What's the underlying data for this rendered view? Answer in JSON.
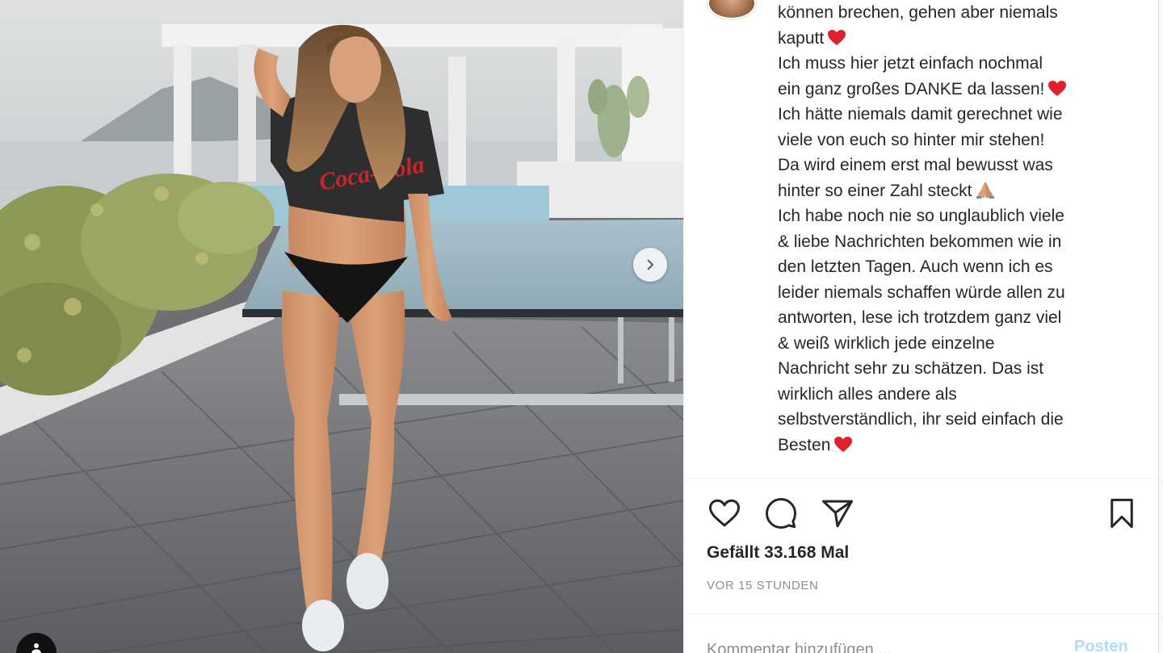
{
  "post": {
    "caption_lines": [
      {
        "text": "können brechen, gehen aber niemals",
        "emoji": ""
      },
      {
        "text": "kaputt",
        "emoji": "heart"
      },
      {
        "text": "Ich muss hier jetzt einfach nochmal",
        "emoji": ""
      },
      {
        "text": "ein ganz großes DANKE da lassen!",
        "emoji": "heart"
      },
      {
        "text": "Ich hätte niemals damit gerechnet wie",
        "emoji": ""
      },
      {
        "text": "viele von euch so hinter mir stehen!",
        "emoji": ""
      },
      {
        "text": "Da wird einem erst mal bewusst was",
        "emoji": ""
      },
      {
        "text": "hinter so einer Zahl steckt",
        "emoji": "folded-hands"
      },
      {
        "text": "Ich habe noch nie so unglaublich viele",
        "emoji": ""
      },
      {
        "text": "& liebe Nachrichten bekommen wie in",
        "emoji": ""
      },
      {
        "text": "den letzten Tagen. Auch wenn ich es",
        "emoji": ""
      },
      {
        "text": "leider niemals schaffen würde allen zu",
        "emoji": ""
      },
      {
        "text": "antworten, lese ich trotzdem ganz viel",
        "emoji": ""
      },
      {
        "text": "& weiß wirklich jede einzelne",
        "emoji": ""
      },
      {
        "text": "Nachricht sehr zu schätzen. Das ist",
        "emoji": ""
      },
      {
        "text": "wirklich alles andere als",
        "emoji": ""
      },
      {
        "text": "selbstverständlich, ihr seid einfach die",
        "emoji": ""
      },
      {
        "text": "Besten",
        "emoji": "heart"
      }
    ],
    "likes_label": "Gefällt 33.168 Mal",
    "timestamp": "VOR 15 STUNDEN"
  },
  "actions": {
    "like_icon": "heart-outline-icon",
    "comment_icon": "comment-bubble-icon",
    "share_icon": "paper-plane-icon",
    "save_icon": "bookmark-icon"
  },
  "comment": {
    "placeholder": "Kommentar hinzufügen ...",
    "post_label": "Posten"
  },
  "photo": {
    "next_icon": "chevron-right-icon",
    "tag_icon": "person-tag-icon",
    "shirt_print": "Coca-Cola"
  },
  "colors": {
    "heart_red": "#e0202e",
    "post_button_disabled": "#b3dbff",
    "muted_text": "#8e8e8e",
    "divider": "#efefef"
  }
}
